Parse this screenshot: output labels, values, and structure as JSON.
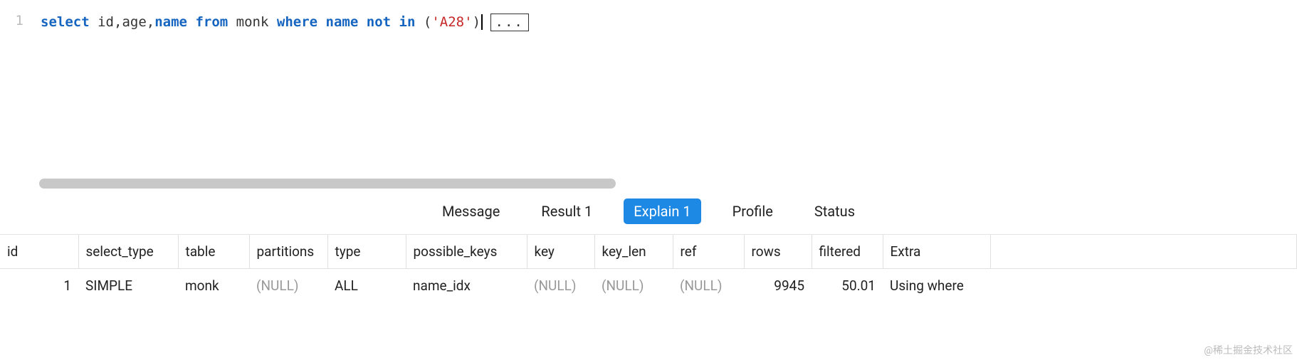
{
  "editor": {
    "line_number": "1",
    "tokens": {
      "select": "select",
      "id": "id",
      "age": "age",
      "name1": "name",
      "from": "from",
      "table": "monk",
      "where": "where",
      "name2": "name",
      "not": "not",
      "in": "in",
      "lparen": "(",
      "quote1": "'",
      "literal": "A28",
      "quote2": "'",
      "rparen": ")",
      "comma1": ",",
      "comma2": ","
    },
    "ellipsis": "..."
  },
  "tabs": {
    "message": "Message",
    "result": "Result 1",
    "explain": "Explain 1",
    "profile": "Profile",
    "status": "Status"
  },
  "table": {
    "headers": {
      "id": "id",
      "select_type": "select_type",
      "table": "table",
      "partitions": "partitions",
      "type": "type",
      "possible_keys": "possible_keys",
      "key": "key",
      "key_len": "key_len",
      "ref": "ref",
      "rows": "rows",
      "filtered": "filtered",
      "extra": "Extra"
    },
    "row": {
      "id": "1",
      "select_type": "SIMPLE",
      "table": "monk",
      "partitions": "(NULL)",
      "type": "ALL",
      "possible_keys": "name_idx",
      "key": "(NULL)",
      "key_len": "(NULL)",
      "ref": "(NULL)",
      "rows": "9945",
      "filtered": "50.01",
      "extra": "Using where"
    }
  },
  "watermark": "@稀土掘金技术社区"
}
